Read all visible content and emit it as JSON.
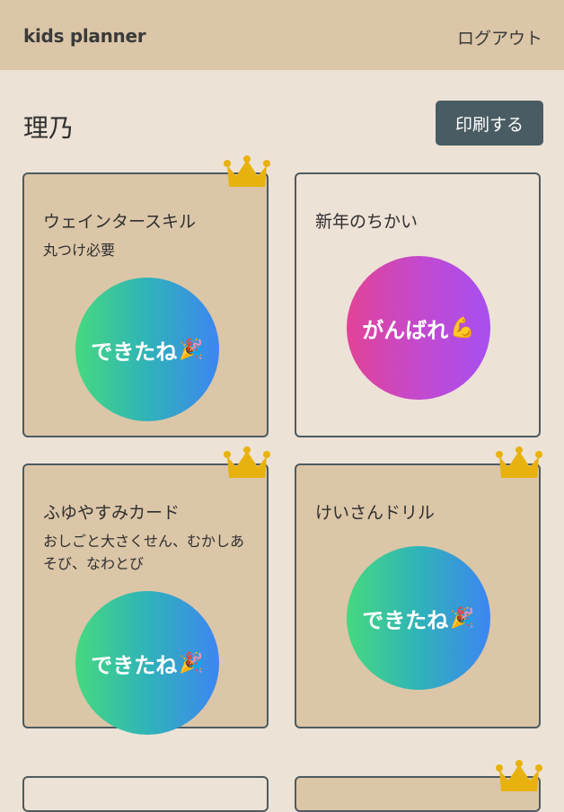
{
  "header": {
    "brand": "kids planner",
    "logout_label": "ログアウト"
  },
  "page": {
    "child_name": "理乃",
    "print_label": "印刷する"
  },
  "cards": [
    {
      "title": "ウェインタースキル",
      "note": "丸つけ必要",
      "status": "done",
      "badge_text": "できたね",
      "badge_emoji": "🎉",
      "crown": true
    },
    {
      "title": "新年のちかい",
      "note": "",
      "status": "todo",
      "badge_text": "がんばれ",
      "badge_emoji": "💪",
      "crown": false
    },
    {
      "title": "ふゆやすみカード",
      "note": "おしごと大さくせん、むかしあそび、なわとび",
      "status": "done",
      "badge_text": "できたね",
      "badge_emoji": "🎉",
      "crown": true
    },
    {
      "title": "けいさんドリル",
      "note": "",
      "status": "done",
      "badge_text": "できたね",
      "badge_emoji": "🎉",
      "crown": true
    }
  ],
  "colors": {
    "header_bg": "#dbc6a8",
    "page_bg": "#ede2d6",
    "done_card_bg": "#dbc6a8",
    "button_bg": "#4a5c63",
    "crown": "#e8b20e"
  }
}
